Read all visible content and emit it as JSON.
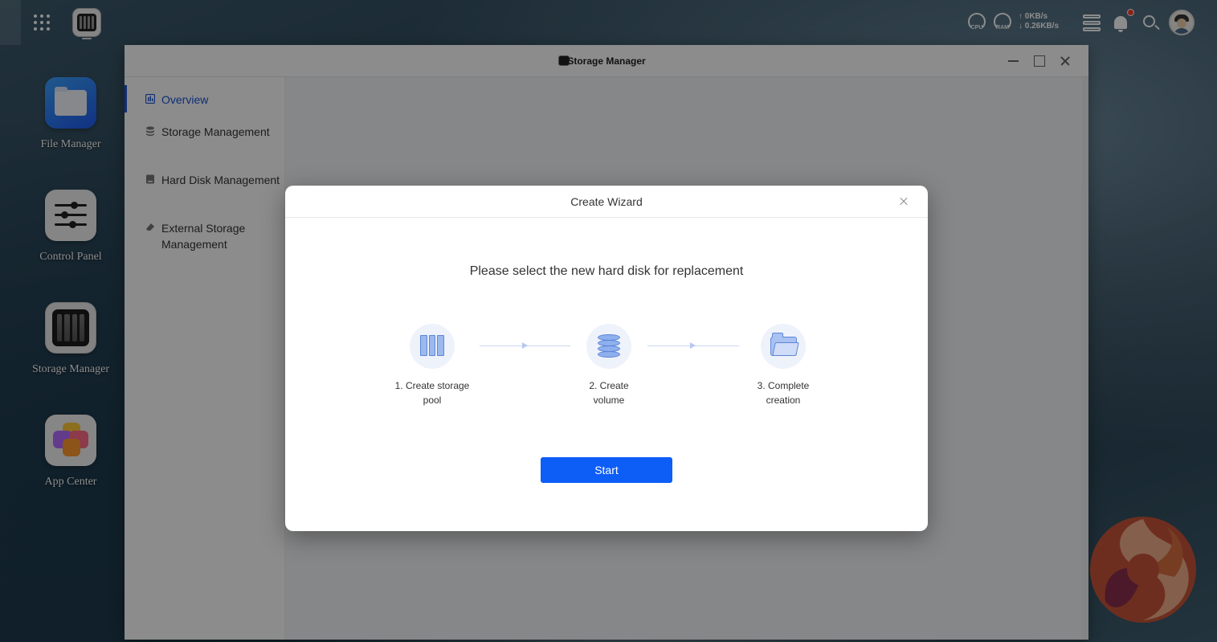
{
  "topbar": {
    "cpu_label": "CPU",
    "ram_label": "RAM",
    "upload_speed": "↑ 0KB/s",
    "download_speed": "↓ 0.26KB/s",
    "icons": [
      "apps-grid-icon",
      "storage-manager-taskbar-icon",
      "cpu-gauge-icon",
      "ram-gauge-icon",
      "server-icon",
      "bell-icon",
      "search-icon",
      "avatar"
    ],
    "notification_dot_color": "#ff3b30"
  },
  "desktop": {
    "icons": [
      {
        "label": "File Manager"
      },
      {
        "label": "Control Panel"
      },
      {
        "label": "Storage Manager"
      },
      {
        "label": "App Center"
      }
    ]
  },
  "window": {
    "title": "Storage Manager",
    "sidebar": [
      {
        "label": "Overview",
        "icon": "chart-icon",
        "active": true
      },
      {
        "label": "Storage Management",
        "icon": "database-icon"
      },
      {
        "label": "Hard Disk Management",
        "icon": "hard-disk-icon"
      },
      {
        "label": "External Storage Management",
        "icon": "eraser-icon"
      }
    ],
    "accent_color": "#1a54d9"
  },
  "wizard": {
    "title": "Create Wizard",
    "prompt": "Please select the new hard disk for replacement",
    "steps": [
      {
        "line1": "1. Create storage",
        "line2": "pool",
        "icon": "storage-pool-icon"
      },
      {
        "line1": "2. Create",
        "line2": "volume",
        "icon": "volume-icon"
      },
      {
        "line1": "3. Complete",
        "line2": "creation",
        "icon": "folder-icon"
      }
    ],
    "start_label": "Start",
    "button_color": "#0d5df7"
  }
}
